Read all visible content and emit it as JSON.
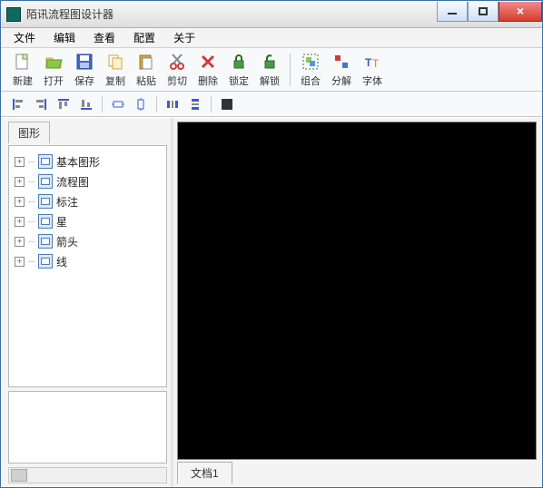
{
  "window": {
    "title": "陌讯流程图设计器"
  },
  "menu": {
    "file": "文件",
    "edit": "编辑",
    "view": "查看",
    "config": "配置",
    "about": "关于"
  },
  "toolbar": {
    "new": "新建",
    "open": "打开",
    "save": "保存",
    "copy": "复制",
    "paste": "粘贴",
    "cut": "剪切",
    "delete": "删除",
    "lock": "锁定",
    "unlock": "解锁",
    "group": "组合",
    "ungroup": "分解",
    "font": "字体"
  },
  "sidepanel": {
    "title": "图形"
  },
  "tree": {
    "items": [
      {
        "label": "基本图形"
      },
      {
        "label": "流程图"
      },
      {
        "label": "标注"
      },
      {
        "label": "星"
      },
      {
        "label": "箭头"
      },
      {
        "label": "线"
      }
    ]
  },
  "document": {
    "tab1": "文档1"
  }
}
